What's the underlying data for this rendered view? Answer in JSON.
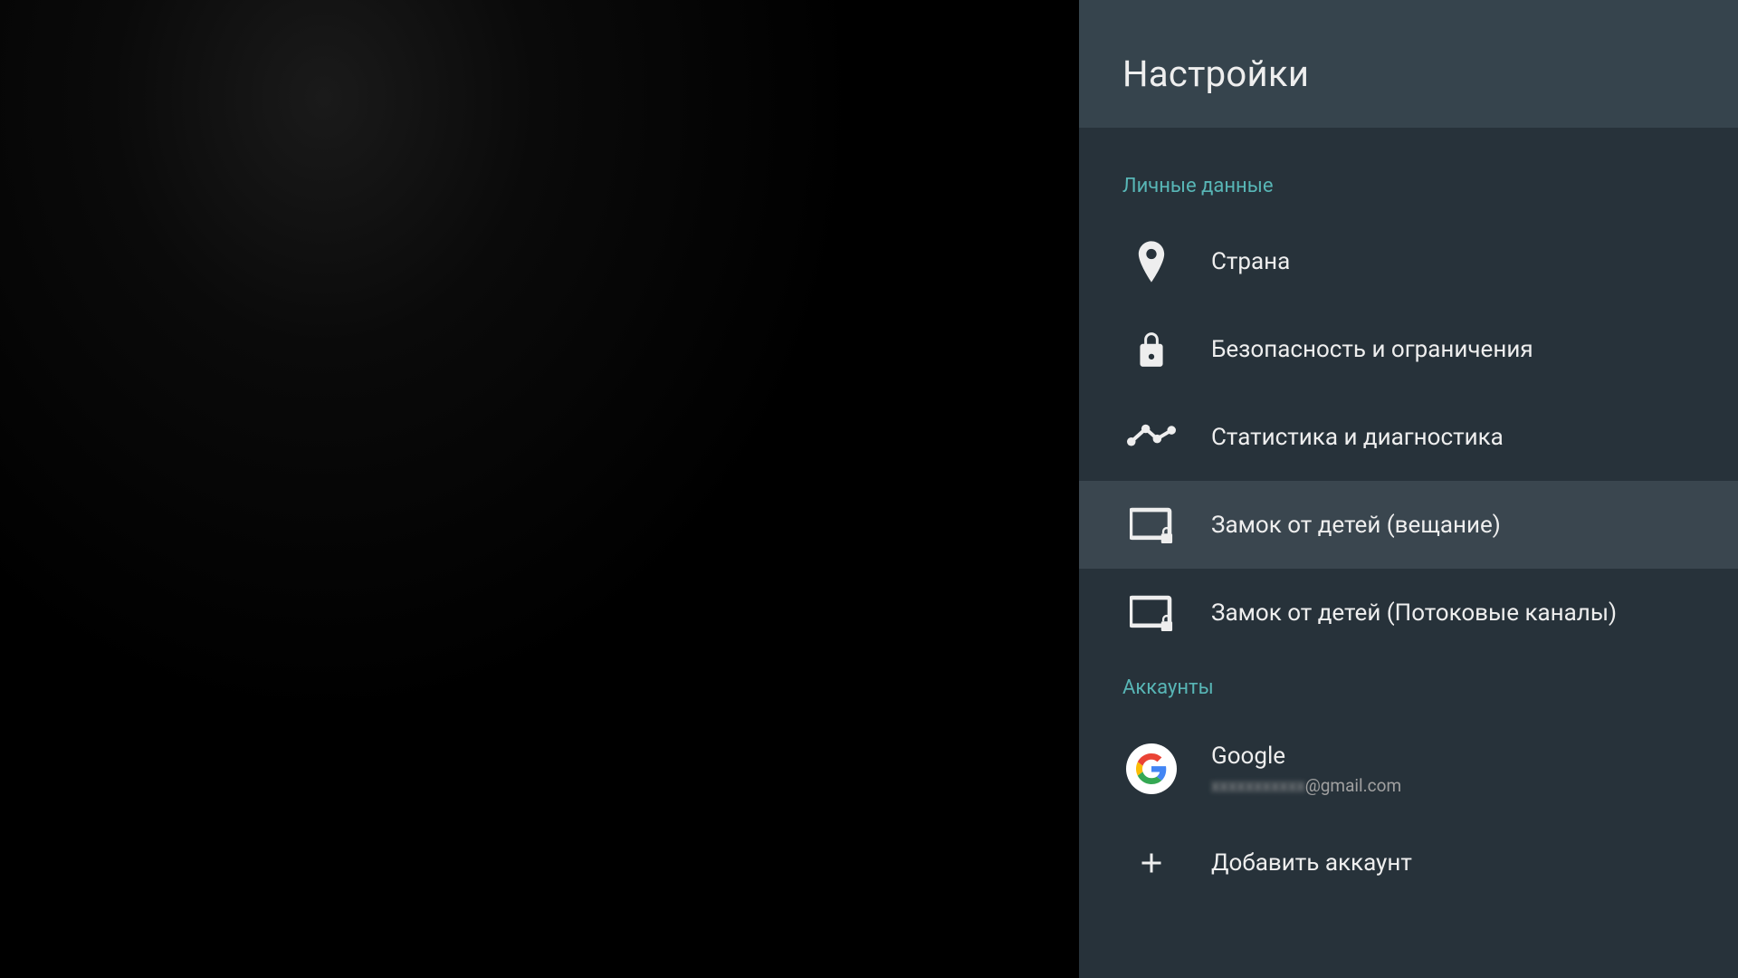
{
  "header": {
    "title": "Настройки"
  },
  "sections": {
    "personal": {
      "header": "Личные данные",
      "items": [
        {
          "label": "Страна"
        },
        {
          "label": "Безопасность и ограничения"
        },
        {
          "label": "Статистика и диагностика"
        },
        {
          "label": "Замок от детей (вещание)"
        },
        {
          "label": "Замок от детей (Потоковые каналы)"
        }
      ]
    },
    "accounts": {
      "header": "Аккаунты",
      "google": {
        "title": "Google",
        "email_prefix": "xxxxxxxxxxx",
        "email_suffix": "@gmail.com"
      },
      "add_account": "Добавить аккаунт"
    }
  }
}
